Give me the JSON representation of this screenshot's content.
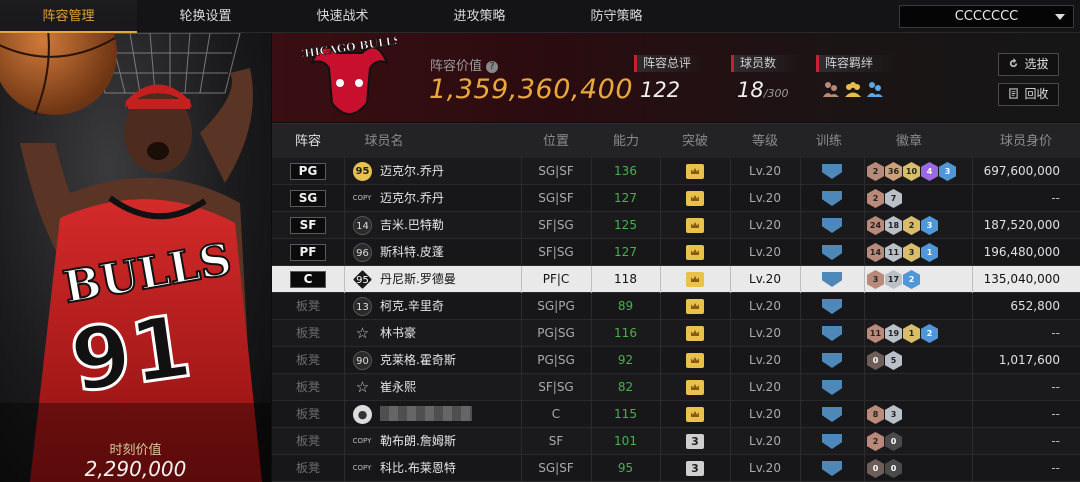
{
  "nav": {
    "tabs": [
      "阵容管理",
      "轮换设置",
      "快速战术",
      "进攻策略",
      "防守策略"
    ],
    "active_index": 0,
    "account": "CCCCCCC"
  },
  "hero": {
    "jersey_team": "BULLS",
    "jersey_number": "91",
    "value_label": "时刻价值",
    "value": "2,290,000"
  },
  "summary": {
    "logo_text": "CHICAGO BULLS",
    "team_value_label": "阵容价值",
    "team_value_help": "?",
    "team_value": "1,359,360,400",
    "rating_label": "阵容总评",
    "rating": "122",
    "players_label": "球员数",
    "players": "18",
    "players_max": "/300",
    "bond_label": "阵容羁绊",
    "select_button": "选拔",
    "recycle_button": "回收"
  },
  "table": {
    "headers": [
      "阵容",
      "球员名",
      "位置",
      "能力",
      "突破",
      "等级",
      "训练",
      "徽章",
      "球员身价"
    ],
    "rows": [
      {
        "slot": "PG",
        "type": "starter",
        "badge_kind": "num",
        "badge_text": "95",
        "name": "迈克尔.乔丹",
        "pos": "SG|SF",
        "ability": "136",
        "breakthrough": "crown",
        "level": "Lv.20",
        "badges": [
          [
            "2",
            "#b9897a"
          ],
          [
            "36",
            "#c9a27a"
          ],
          [
            "10",
            "#d9bd6a"
          ],
          [
            "4",
            "#9b6ae0"
          ],
          [
            "3",
            "#4f97d6"
          ]
        ],
        "value": "697,600,000"
      },
      {
        "slot": "SG",
        "type": "starter",
        "badge_kind": "copy",
        "badge_text": "COPY",
        "name": "迈克尔.乔丹",
        "pos": "SG|SF",
        "ability": "127",
        "breakthrough": "crown",
        "level": "Lv.20",
        "badges": [
          [
            "2",
            "#b9897a"
          ],
          [
            "7",
            "#b9c0c8"
          ]
        ],
        "value": "--"
      },
      {
        "slot": "SF",
        "type": "starter",
        "badge_kind": "plain",
        "badge_text": "14",
        "name": "吉米.巴特勒",
        "pos": "SF|SG",
        "ability": "125",
        "breakthrough": "crown",
        "level": "Lv.20",
        "badges": [
          [
            "24",
            "#b9897a"
          ],
          [
            "18",
            "#b9c0c8"
          ],
          [
            "2",
            "#d9bd6a"
          ],
          [
            "3",
            "#4f97d6"
          ]
        ],
        "value": "187,520,000"
      },
      {
        "slot": "PF",
        "type": "starter",
        "badge_kind": "plain",
        "badge_text": "96",
        "name": "斯科特.皮蓬",
        "pos": "SF|SG",
        "ability": "127",
        "breakthrough": "crown",
        "level": "Lv.20",
        "badges": [
          [
            "14",
            "#b9897a"
          ],
          [
            "11",
            "#b9c0c8"
          ],
          [
            "3",
            "#d9bd6a"
          ],
          [
            "1",
            "#4f97d6"
          ]
        ],
        "value": "196,480,000"
      },
      {
        "slot": "C",
        "type": "selected",
        "badge_kind": "dark",
        "badge_text": "95",
        "name": "丹尼斯.罗德曼",
        "pos": "PF|C",
        "ability": "118",
        "breakthrough": "crown",
        "level": "Lv.20",
        "badges": [
          [
            "3",
            "#b9897a"
          ],
          [
            "17",
            "#b9c0c8"
          ],
          [
            "2",
            "#4f97d6"
          ]
        ],
        "value": "135,040,000"
      },
      {
        "slot": "板凳",
        "type": "bench",
        "badge_kind": "plain",
        "badge_text": "13",
        "name": "柯克.辛里奇",
        "pos": "SG|PG",
        "ability": "89",
        "breakthrough": "crown",
        "level": "Lv.20",
        "badges": [],
        "value": "652,800"
      },
      {
        "slot": "板凳",
        "type": "bench",
        "badge_kind": "star",
        "badge_text": "",
        "name": "林书豪",
        "pos": "PG|SG",
        "ability": "116",
        "breakthrough": "crown",
        "level": "Lv.20",
        "badges": [
          [
            "11",
            "#b9897a"
          ],
          [
            "19",
            "#b9c0c8"
          ],
          [
            "1",
            "#d9bd6a"
          ],
          [
            "2",
            "#4f97d6"
          ]
        ],
        "value": "--"
      },
      {
        "slot": "板凳",
        "type": "bench",
        "badge_kind": "plain",
        "badge_text": "90",
        "name": "克莱格.霍奇斯",
        "pos": "PG|SG",
        "ability": "92",
        "breakthrough": "crown",
        "level": "Lv.20",
        "badges": [
          [
            "0",
            "#6d5e59"
          ],
          [
            "5",
            "#b9c0c8"
          ]
        ],
        "value": "1,017,600"
      },
      {
        "slot": "板凳",
        "type": "bench",
        "badge_kind": "star",
        "badge_text": "",
        "name": "崔永熙",
        "pos": "SF|SG",
        "ability": "82",
        "breakthrough": "crown",
        "level": "Lv.20",
        "badges": [],
        "value": "--"
      },
      {
        "slot": "板凳",
        "type": "bench",
        "badge_kind": "person",
        "badge_text": "",
        "name": "",
        "pos": "C",
        "ability": "115",
        "breakthrough": "crown",
        "level": "Lv.20",
        "badges": [
          [
            "8",
            "#b9897a"
          ],
          [
            "3",
            "#b9c0c8"
          ]
        ],
        "value": "--"
      },
      {
        "slot": "板凳",
        "type": "bench",
        "badge_kind": "copy",
        "badge_text": "COPY",
        "name": "勒布朗.詹姆斯",
        "pos": "SF",
        "ability": "101",
        "breakthrough": "3",
        "level": "Lv.20",
        "badges": [
          [
            "2",
            "#b9897a"
          ],
          [
            "0",
            "#4a4a4a"
          ]
        ],
        "value": "--"
      },
      {
        "slot": "板凳",
        "type": "bench",
        "badge_kind": "copy",
        "badge_text": "COPY",
        "name": "科比.布莱恩特",
        "pos": "SG|SF",
        "ability": "95",
        "breakthrough": "3",
        "level": "Lv.20",
        "badges": [
          [
            "0",
            "#6d5e59"
          ],
          [
            "0",
            "#4a4a4a"
          ]
        ],
        "value": "--"
      }
    ]
  }
}
